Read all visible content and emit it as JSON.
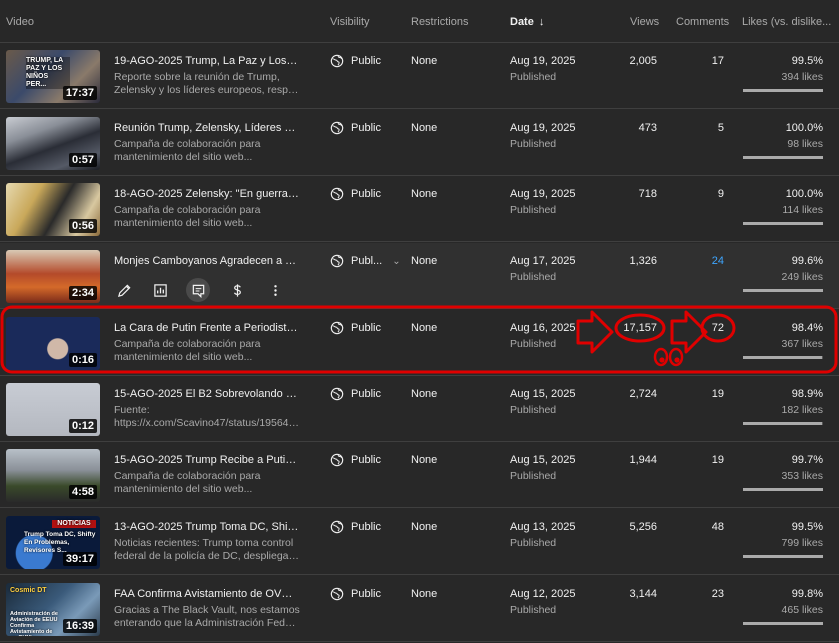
{
  "columns": {
    "video": "Video",
    "visibility": "Visibility",
    "restrictions": "Restrictions",
    "date": "Date",
    "views": "Views",
    "comments": "Comments",
    "likes": "Likes (vs. dislike..."
  },
  "colors": {
    "background": "#282828",
    "annotation": "#e00000",
    "link": "#3ea6ff"
  },
  "rows": [
    {
      "title": "19-AGO-2025 Trump, La Paz y Los Niñ...",
      "desc1": "Reporte sobre la reunión de Trump,",
      "desc2": "Zelensky y los líderes europeos, respecto...",
      "duration": "17:37",
      "thumb_caption": "TRUMP, LA PAZ Y LOS NIÑOS PER...",
      "visibility": "Public",
      "restrictions": "None",
      "date": "Aug 19, 2025",
      "status": "Published",
      "views": "2,005",
      "comments": "17",
      "likes_pct": "99.5%",
      "likes": "394 likes",
      "likes_fraction": 0.995
    },
    {
      "title": "Reunión Trump, Zelensky, Líderes de E...",
      "desc1": "Campaña de colaboración para",
      "desc2": "mantenimiento del sitio web...",
      "duration": "0:57",
      "thumb_caption": "",
      "visibility": "Public",
      "restrictions": "None",
      "date": "Aug 19, 2025",
      "status": "Published",
      "views": "473",
      "comments": "5",
      "likes_pct": "100.0%",
      "likes": "98 likes",
      "likes_fraction": 1.0
    },
    {
      "title": "18-AGO-2025 Zelensky: \"En guerra no ...",
      "desc1": "Campaña de colaboración para",
      "desc2": "mantenimiento del sitio web...",
      "duration": "0:56",
      "thumb_caption": "",
      "visibility": "Public",
      "restrictions": "None",
      "date": "Aug 19, 2025",
      "status": "Published",
      "views": "718",
      "comments": "9",
      "likes_pct": "100.0%",
      "likes": "114 likes",
      "likes_fraction": 1.0
    },
    {
      "title": "Monjes Camboyanos Agradecen a Tru...",
      "desc1": "",
      "desc2": "",
      "duration": "2:34",
      "thumb_caption": "",
      "visibility": "Publ...",
      "restrictions": "None",
      "date": "Aug 17, 2025",
      "status": "Published",
      "views": "1,326",
      "comments": "24",
      "likes_pct": "99.6%",
      "likes": "249 likes",
      "likes_fraction": 0.996
    },
    {
      "title": "La Cara de Putin Frente a Periodistas ...",
      "desc1": "Campaña de colaboración para",
      "desc2": "mantenimiento del sitio web...",
      "duration": "0:16",
      "thumb_caption": "",
      "visibility": "Public",
      "restrictions": "None",
      "date": "Aug 16, 2025",
      "status": "Published",
      "views": "17,157",
      "comments": "72",
      "likes_pct": "98.4%",
      "likes": "367 likes",
      "likes_fraction": 0.984
    },
    {
      "title": "15-AGO-2025 El B2 Sobrevolando en H...",
      "desc1": "Fuente:",
      "desc2": "https://x.com/Scavino47/status/195643...",
      "duration": "0:12",
      "thumb_caption": "",
      "visibility": "Public",
      "restrictions": "None",
      "date": "Aug 15, 2025",
      "status": "Published",
      "views": "2,724",
      "comments": "19",
      "likes_pct": "98.9%",
      "likes": "182 likes",
      "likes_fraction": 0.989
    },
    {
      "title": "15-AGO-2025 Trump Recibe a Putin en...",
      "desc1": "Campaña de colaboración para",
      "desc2": "mantenimiento del sitio web...",
      "duration": "4:58",
      "thumb_caption": "",
      "visibility": "Public",
      "restrictions": "None",
      "date": "Aug 15, 2025",
      "status": "Published",
      "views": "1,944",
      "comments": "19",
      "likes_pct": "99.7%",
      "likes": "353 likes",
      "likes_fraction": 0.997
    },
    {
      "title": "13-AGO-2025 Trump Toma DC, Shifty e...",
      "desc1": "Noticias recientes: Trump toma control",
      "desc2": "federal de la policía de DC, despliega la...",
      "duration": "39:17",
      "thumb_caption": "Trump Toma DC, Shifty En Problemas, Revisores S...",
      "visibility": "Public",
      "restrictions": "None",
      "date": "Aug 13, 2025",
      "status": "Published",
      "views": "5,256",
      "comments": "48",
      "likes_pct": "99.5%",
      "likes": "799 likes",
      "likes_fraction": 0.995
    },
    {
      "title": "FAA Confirma Avistamiento de OVNI e...",
      "desc1": "Gracias a The Black Vault, nos estamos",
      "desc2": "enterando que la Administración Federal...",
      "duration": "16:39",
      "thumb_caption": "Administración de Aviación de EEUU Confirma Avistamiento de un OVNI",
      "visibility": "Public",
      "restrictions": "None",
      "date": "Aug 12, 2025",
      "status": "Published",
      "views": "3,144",
      "comments": "23",
      "likes_pct": "99.8%",
      "likes": "465 likes",
      "likes_fraction": 0.998
    }
  ],
  "thumb_overlays": {
    "row0_top": "TRUMP, LA PAZ",
    "row7_top": "NOTICIAS",
    "row8_top": "Cosmic DT"
  }
}
